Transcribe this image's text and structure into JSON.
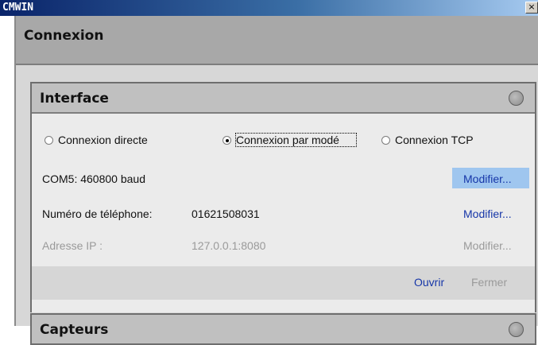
{
  "window": {
    "title": "CMWIN",
    "close_glyph": "×"
  },
  "connexion": {
    "title": "Connexion"
  },
  "interface_panel": {
    "title": "Interface",
    "status_icon": "status-led-icon",
    "radios": [
      {
        "label": "Connexion directe",
        "selected": false
      },
      {
        "label": "Connexion par modé",
        "selected": true
      },
      {
        "label": "Connexion TCP",
        "selected": false
      }
    ],
    "com_port": {
      "label": "COM5: 460800 baud",
      "action": "Modifier..."
    },
    "phone": {
      "label": "Numéro de téléphone:",
      "value": "01621508031",
      "action": "Modifier..."
    },
    "ip": {
      "label": "Adresse IP :",
      "value": "127.0.0.1:8080",
      "action": "Modifier..."
    },
    "footer": {
      "open": "Ouvrir",
      "close": "Fermer"
    }
  },
  "second_panel": {
    "title": "Capteurs"
  }
}
